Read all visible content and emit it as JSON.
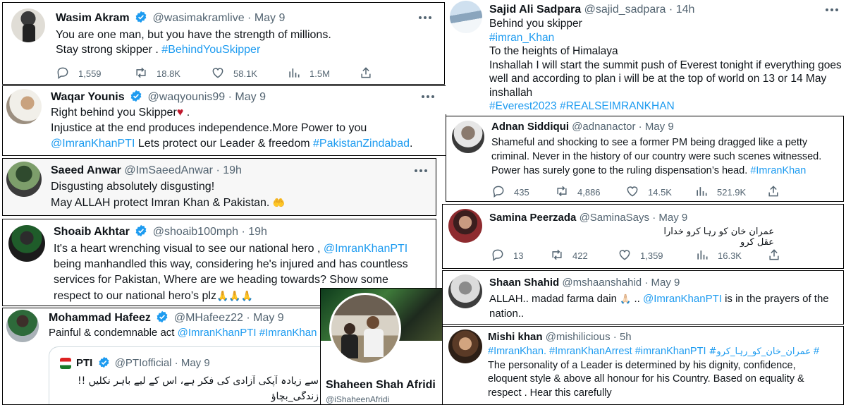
{
  "colors": {
    "link": "#1d9bf0",
    "meta": "#536471",
    "heart": "#c0182d"
  },
  "icons": [
    "verified-badge-icon",
    "reply-icon",
    "retweet-icon",
    "like-icon",
    "views-icon",
    "share-icon",
    "more-icon",
    "flag-icon"
  ],
  "wasim": {
    "name": "Wasim Akram",
    "handle": "@wasimakramlive",
    "time": "May 9",
    "line1": "You are one man, but you have the strength of millions.",
    "line2a": "Stay strong skipper . ",
    "tag": "#BehindYouSkipper",
    "replies": "1,559",
    "retweets": "18.8K",
    "likes": "58.1K",
    "views": "1.5M"
  },
  "waqar": {
    "name": "Waqar Younis",
    "handle": "@waqyounis99",
    "time": "May 9",
    "line1": "Right behind you Skipper",
    "emoji": "♥",
    "line1b": " .",
    "line2": "Injustice at the end produces independence.More Power to you",
    "mention": "@ImranKhanPTI",
    "line3": " Lets protect our Leader & freedom ",
    "tag": "#PakistanZindabad",
    "dot": "."
  },
  "saeed": {
    "name": "Saeed Anwar",
    "handle": "@ImSaeedAnwar",
    "time": "19h",
    "line1": "Disgusting absolutely disgusting!",
    "line2": "May ALLAH protect Imran Khan & Pakistan. ",
    "emoji": "🤲"
  },
  "shoaib": {
    "name": "Shoaib Akhtar",
    "handle": "@shoaib100mph",
    "time": "19h",
    "line1": "It's a heart wrenching visual to see our national hero , ",
    "mention": "@ImranKhanPTI",
    "line2": "being manhandled this way, considering he's injured and has countless",
    "line3": "services for Pakistan, Where are we heading towards? Show some",
    "line4": "respect to our national hero’s plz",
    "emoji": "🙏🙏🙏"
  },
  "hafeez": {
    "name": "Mohammad Hafeez",
    "handle": "@MHafeez22",
    "time": "May 9",
    "line1": "Painful & condemnable act ",
    "mention": "@ImranKhanPTI",
    "tag": "#ImranKhan",
    "quote": {
      "name": "PTI",
      "handle": "@PTIofficial",
      "time": "May 9",
      "urdu1": "سے زیادہ آپکی آزادی کی فکر ہے، اس کے لیے باہر نکلیں !!",
      "urdu2": "زندگی_بچاؤ"
    }
  },
  "shaheen": {
    "name": "Shaheen Shah Afridi",
    "handle": "@iShaheenAfridi"
  },
  "sajid": {
    "name": "Sajid Ali Sadpara",
    "handle": "@sajid_sadpara",
    "time": "14h",
    "line1": "Behind you skipper",
    "tag1": "#imran_Khan",
    "line3": "To the heights of  Himalaya",
    "line4": "Inshallah I will start the summit push of Everest tonight if everything goes",
    "line5": "well and according to plan i will be at the top of world on 13 or 14 May",
    "line6": "inshallah",
    "tags": "#Everest2023 #REALSEIMRANKHAN"
  },
  "adnan": {
    "name": "Adnan Siddiqui",
    "handle": "@adnanactor",
    "time": "May 9",
    "line1": "Shameful and shocking to see a former PM being dragged like a petty",
    "line2": "criminal. Never in the history of our country were such scenes witnessed.",
    "line3": "Power has surely gone to the ruling dispensation’s head. ",
    "tag": "#ImranKhan",
    "replies": "435",
    "retweets": "4,886",
    "likes": "14.5K",
    "views": "521.9K"
  },
  "samina": {
    "name": "Samina Peerzada",
    "handle": "@SaminaSays",
    "time": "May 9",
    "urdu": "عمران خان کو رہا کرو خدارا عقل کرو",
    "replies": "13",
    "retweets": "422",
    "likes": "1,359",
    "views": "16.3K"
  },
  "shaan": {
    "name": "Shaan Shahid",
    "handle": "@mshaanshahid",
    "time": "May 9",
    "line1": "ALLAH.. madad farma dain ",
    "emoji": "🙏🏻",
    "line1b": " .. ",
    "mention": "@ImranKhanPTI",
    "line1c": " is in the prayers of the",
    "line2": "nation.."
  },
  "mishi": {
    "name": "Mishi khan",
    "handle": "@mishilicious",
    "time": "5h",
    "tags": "#ImranKhan. #ImranKhanArrest #imranKhanPTI",
    "urduTag": "#عمران_خان_کو_رہا_کرو",
    "hash": " #",
    "line2": "The personality of a Leader is determined by his dignity, confidence,",
    "line3": "eloquent style & above all honour for his Country. Based on equality &",
    "line4": "respect . Hear this carefully"
  }
}
